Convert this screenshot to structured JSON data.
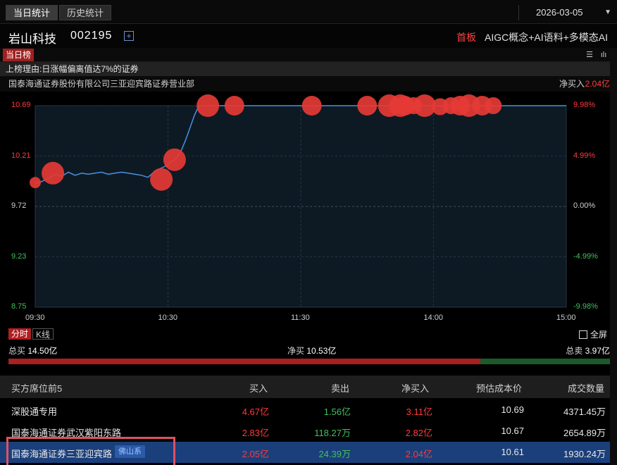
{
  "tabs": [
    {
      "label": "当日统计",
      "active": true
    },
    {
      "label": "历史统计",
      "active": false
    }
  ],
  "date": "2026-03-05",
  "stock": {
    "name": "岩山科技",
    "code": "002195",
    "plus": "+"
  },
  "board_label": "首板",
  "concepts": "AIGC概念+AI语料+多模态AI",
  "section_tag": "当日榜",
  "reason": "上榜理由:日涨幅偏离值达7%的证券",
  "broker": "国泰海通证券股份有限公司三亚迎宾路证券营业部",
  "net_buy_label": "净买入",
  "net_buy_value": "2.04亿",
  "colors": {
    "up": "#ff3b3b",
    "down": "#40c060",
    "line": "#4a90e2",
    "bubble": "#e53935",
    "highlight": "#1b3f7a"
  },
  "chart_data": {
    "type": "line",
    "x_ticks": [
      "09:30",
      "10:30",
      "11:30",
      "14:00",
      "15:00"
    ],
    "y_left_ticks": [
      "10.69",
      "10.21",
      "9.72",
      "9.23",
      "8.75"
    ],
    "y_right_ticks": [
      "9.98%",
      "4.99%",
      "0.00%",
      "-4.99%",
      "-9.98%"
    ],
    "ylim": [
      8.75,
      10.69
    ],
    "prev_close": 9.72,
    "series": [
      {
        "x_minutes": [
          0,
          3,
          6,
          9,
          12,
          15,
          18,
          21,
          24,
          27,
          30,
          33,
          36,
          39,
          42,
          45,
          48,
          51,
          54,
          57,
          60,
          62,
          64,
          66,
          68,
          70,
          72,
          74,
          76,
          78,
          80,
          90,
          120,
          150,
          180,
          210,
          240
        ],
        "values": [
          9.94,
          9.96,
          9.99,
          10.03,
          10.01,
          10.05,
          10.02,
          10.04,
          10.03,
          10.04,
          10.05,
          10.03,
          10.04,
          10.05,
          10.04,
          10.03,
          10.02,
          10.0,
          10.06,
          10.09,
          10.12,
          10.16,
          10.19,
          10.26,
          10.36,
          10.48,
          10.6,
          10.69,
          10.69,
          10.69,
          10.69,
          10.69,
          10.69,
          10.69,
          10.69,
          10.69,
          10.69
        ]
      }
    ],
    "trade_bubbles": [
      {
        "t": 0,
        "price": 9.95,
        "size": 1
      },
      {
        "t": 8,
        "price": 10.04,
        "size": 3
      },
      {
        "t": 57,
        "price": 9.98,
        "size": 3
      },
      {
        "t": 63,
        "price": 10.17,
        "size": 3
      },
      {
        "t": 78,
        "price": 10.69,
        "size": 3
      },
      {
        "t": 90,
        "price": 10.69,
        "size": 2.5
      },
      {
        "t": 125,
        "price": 10.69,
        "size": 2.5
      },
      {
        "t": 150,
        "price": 10.69,
        "size": 2.5
      },
      {
        "t": 160,
        "price": 10.69,
        "size": 3
      },
      {
        "t": 165,
        "price": 10.69,
        "size": 3
      },
      {
        "t": 167,
        "price": 10.69,
        "size": 2.5
      },
      {
        "t": 171,
        "price": 10.69,
        "size": 2
      },
      {
        "t": 176,
        "price": 10.69,
        "size": 3
      },
      {
        "t": 183,
        "price": 10.68,
        "size": 2
      },
      {
        "t": 188,
        "price": 10.69,
        "size": 2
      },
      {
        "t": 192,
        "price": 10.69,
        "size": 2.5
      },
      {
        "t": 196,
        "price": 10.69,
        "size": 3
      },
      {
        "t": 202,
        "price": 10.69,
        "size": 2.5
      },
      {
        "t": 207,
        "price": 10.69,
        "size": 2
      }
    ]
  },
  "mode_tabs": [
    {
      "label": "分时",
      "active": true
    },
    {
      "label": "K线",
      "active": false
    }
  ],
  "fullscreen_label": "全屏",
  "totals": {
    "buy_label": "总买",
    "buy_value": "14.50亿",
    "net_label": "净买",
    "net_value": "10.53亿",
    "sell_label": "总卖",
    "sell_value": "3.97亿",
    "buy_ratio": 0.785
  },
  "table": {
    "headers": [
      "买方席位前5",
      "买入",
      "卖出",
      "净买入",
      "预估成本价",
      "成交数量"
    ],
    "rows": [
      {
        "name": "深股通专用",
        "tag": "",
        "buy": "4.67亿",
        "sell": "1.56亿",
        "net": "3.11亿",
        "cost": "10.69",
        "volume": "4371.45万",
        "highlight": false
      },
      {
        "name": "国泰海通证券武汉紫阳东路",
        "tag": "",
        "buy": "2.83亿",
        "sell": "118.27万",
        "net": "2.82亿",
        "cost": "10.67",
        "volume": "2654.89万",
        "highlight": false
      },
      {
        "name": "国泰海通证券三亚迎宾路",
        "tag": "佛山系",
        "buy": "2.05亿",
        "sell": "24.39万",
        "net": "2.04亿",
        "cost": "10.61",
        "volume": "1930.24万",
        "highlight": true
      }
    ]
  }
}
